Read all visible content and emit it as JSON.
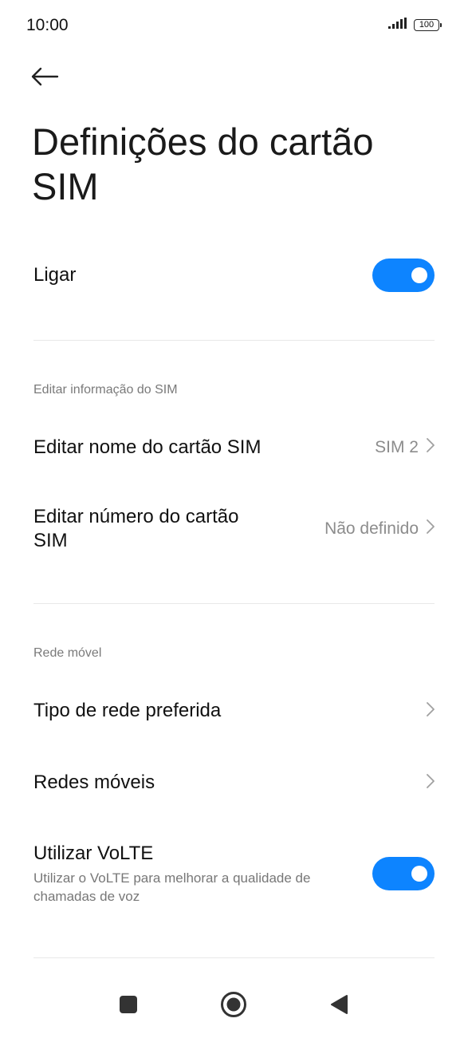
{
  "status_bar": {
    "time": "10:00",
    "battery_level": "100",
    "signal_icon": "cellular-signal-icon"
  },
  "header": {
    "back_icon": "arrow-left-icon",
    "title": "Definições do cartão SIM"
  },
  "main": {
    "power_toggle": {
      "label": "Ligar",
      "on": true
    },
    "sim_info_section": {
      "header": "Editar informação do SIM",
      "items": [
        {
          "label": "Editar nome do cartão SIM",
          "value": "SIM 2"
        },
        {
          "label": "Editar número do cartão SIM",
          "value": "Não definido"
        }
      ]
    },
    "mobile_network_section": {
      "header": "Rede móvel",
      "items": [
        {
          "label": "Tipo de rede preferida"
        },
        {
          "label": "Redes móveis"
        }
      ],
      "volte": {
        "label": "Utilizar VoLTE",
        "description": "Utilizar o VoLTE para melhorar a qualidade de chamadas de voz",
        "on": true
      }
    }
  },
  "navigation_bar": {
    "recents_icon": "square-recents-icon",
    "home_icon": "circle-home-icon",
    "back_icon": "triangle-back-icon"
  },
  "colors": {
    "accent": "#0d84ff",
    "secondary_text": "#8c8c8c",
    "divider": "#e8e8e8"
  }
}
